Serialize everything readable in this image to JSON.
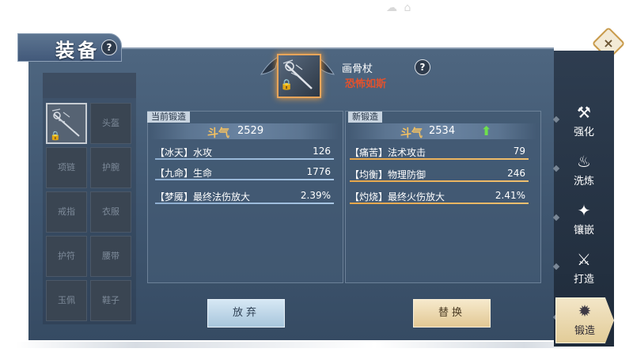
{
  "header": {
    "title": "装备",
    "help": "?"
  },
  "close": {
    "label": "×"
  },
  "left_slots": {
    "header": "",
    "slots": [
      "头盔",
      "项链",
      "护腕",
      "戒指",
      "衣服",
      "护符",
      "腰带",
      "玉佩",
      "鞋子"
    ]
  },
  "item": {
    "name": "画骨杖",
    "subtitle": "恐怖如斯",
    "help": "?",
    "lock": "🔒"
  },
  "current_forge": {
    "label": "当前锻造",
    "power_icon": "斗气",
    "power": "2529",
    "stats": [
      {
        "name": "【冰天】水攻",
        "value": "126"
      },
      {
        "name": "【九命】生命",
        "value": "1776"
      },
      {
        "name": "【梦魇】最终法伤放大",
        "value": "2.39%"
      }
    ]
  },
  "new_forge": {
    "label": "新锻造",
    "power_icon": "斗气",
    "power": "2534",
    "arrow": "⬆",
    "stats": [
      {
        "name": "【痛苦】法术攻击",
        "value": "79"
      },
      {
        "name": "【均衡】物理防御",
        "value": "246"
      },
      {
        "name": "【灼烧】最终火伤放大",
        "value": "2.41%"
      }
    ]
  },
  "buttons": {
    "abandon": "放弃",
    "replace": "替换"
  },
  "nav": [
    {
      "label": "强化",
      "icon": "upgrade-icon",
      "glyph": "⚒"
    },
    {
      "label": "洗炼",
      "icon": "refine-icon",
      "glyph": "♨"
    },
    {
      "label": "镶嵌",
      "icon": "gem-icon",
      "glyph": "✦"
    },
    {
      "label": "打造",
      "icon": "craft-icon",
      "glyph": "⚔"
    },
    {
      "label": "锻造",
      "icon": "forge-icon",
      "glyph": "✹"
    }
  ],
  "colors": {
    "accent": "#e8a55a",
    "subtitle_red": "#e0522e",
    "up_green": "#6ee04c"
  }
}
